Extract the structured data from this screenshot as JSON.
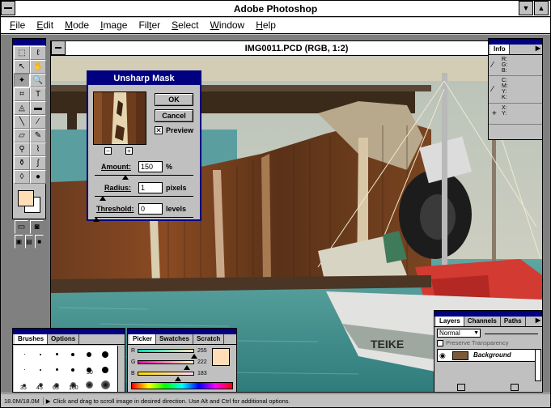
{
  "app": {
    "title": "Adobe Photoshop"
  },
  "menu": [
    {
      "label": "File",
      "key": "F"
    },
    {
      "label": "Edit",
      "key": "E"
    },
    {
      "label": "Mode",
      "key": "M"
    },
    {
      "label": "Image",
      "key": "I"
    },
    {
      "label": "Filter",
      "key": "t"
    },
    {
      "label": "Select",
      "key": "S"
    },
    {
      "label": "Window",
      "key": "W"
    },
    {
      "label": "Help",
      "key": "H"
    }
  ],
  "document": {
    "title": "IMG0011.PCD (RGB, 1:2)"
  },
  "unsharp": {
    "title": "Unsharp Mask",
    "ok_label": "OK",
    "cancel_label": "Cancel",
    "preview_label": "Preview",
    "preview_checked": true,
    "amount_label": "Amount:",
    "amount_value": "150",
    "amount_unit": "%",
    "radius_label": "Radius:",
    "radius_value": "1",
    "radius_unit": "pixels",
    "threshold_label": "Threshold:",
    "threshold_value": "0",
    "threshold_unit": "levels"
  },
  "info": {
    "tab": "Info",
    "rows": [
      {
        "icon": "eyedropper-icon",
        "labels": [
          "R:",
          "G:",
          "B:"
        ]
      },
      {
        "icon": "eyedropper-icon",
        "labels": [
          "C:",
          "M:",
          "Y:",
          "K:"
        ]
      },
      {
        "icon": "crosshair-icon",
        "labels": [
          "X:",
          "Y:"
        ]
      }
    ]
  },
  "brushes": {
    "tabs": [
      "Brushes",
      "Options"
    ],
    "sizes": [
      "35",
      "45",
      "65",
      "100"
    ],
    "label_30": "30"
  },
  "picker": {
    "tabs": [
      "Picker",
      "Swatches",
      "Scratch"
    ],
    "channels": [
      {
        "label": "R",
        "value": "255"
      },
      {
        "label": "G",
        "value": "222"
      },
      {
        "label": "B",
        "value": "183"
      }
    ],
    "fg_color": "#ffdeb7"
  },
  "layers": {
    "tabs": [
      "Layers",
      "Channels",
      "Paths"
    ],
    "mode": "Normal",
    "preserve_label": "Preserve Transparency",
    "layer_name": "Background"
  },
  "status": {
    "size": "18.0M/18.0M",
    "hint": "Click and drag to scroll image in desired direction.  Use Alt and Ctrl for additional options."
  },
  "colors": {
    "title_bar": "#000080",
    "window_bg": "#c0c0c0"
  }
}
